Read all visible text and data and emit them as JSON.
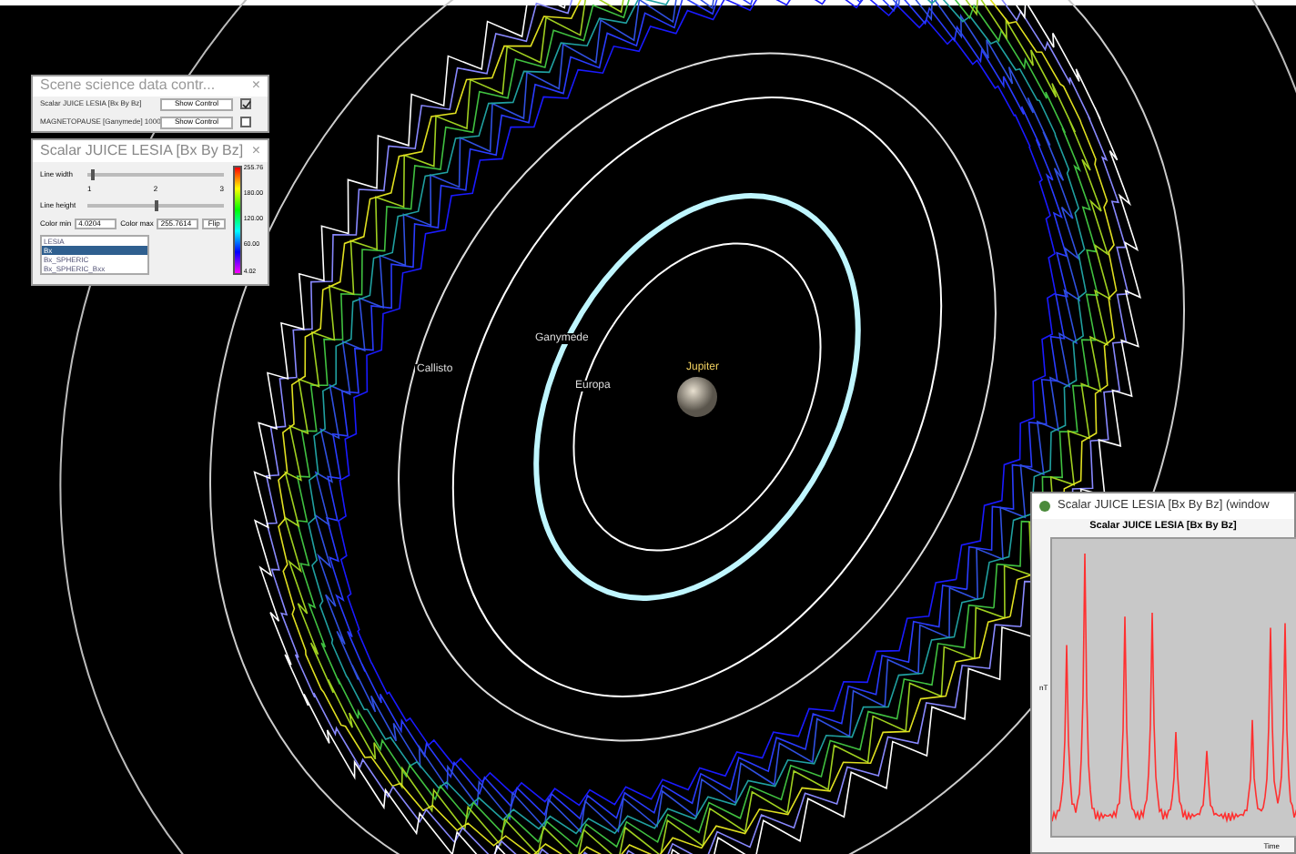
{
  "scene": {
    "labels": [
      {
        "text": "Callisto",
        "kind": "moon"
      },
      {
        "text": "Ganymede",
        "kind": "moon"
      },
      {
        "text": "Europa",
        "kind": "moon"
      },
      {
        "text": "Jupiter",
        "kind": "planet"
      }
    ]
  },
  "control_panel": {
    "title": "Scene science data contr...",
    "close": "×",
    "rows": [
      {
        "label": "Scalar JUICE LESIA [Bx By Bz]",
        "button": "Show Control",
        "checked": true
      },
      {
        "label": "MAGNETOPAUSE [Ganymede] 1000",
        "button": "Show Control",
        "checked": false
      }
    ]
  },
  "scalar_panel": {
    "title": "Scalar JUICE LESIA  [Bx By Bz]",
    "close": "×",
    "line_width": {
      "label": "Line width",
      "level": 0.03,
      "ticks": [
        "1",
        "2",
        "3"
      ]
    },
    "line_height": {
      "label": "Line height",
      "level": 0.5
    },
    "color_min": {
      "label": "Color min",
      "value": "4.0204"
    },
    "color_max": {
      "label": "Color max",
      "value": "255.7614"
    },
    "flip_button": "Flip",
    "colorbar_labels": [
      "255.76",
      "180.00",
      "120.00",
      "60.00",
      "4.02"
    ],
    "list": [
      {
        "text": "LESIA",
        "selected": false
      },
      {
        "text": "Bx",
        "selected": true
      },
      {
        "text": "Bx_SPHERIC",
        "selected": false
      },
      {
        "text": "Bx_SPHERIC_Bxx",
        "selected": false
      }
    ]
  },
  "chart_window": {
    "title": "Scalar JUICE LESIA  [Bx By Bz] (window",
    "chart_title": "Scalar JUICE LESIA  [Bx By Bz]",
    "ylabel": "nT",
    "xlabel": "Time"
  }
}
